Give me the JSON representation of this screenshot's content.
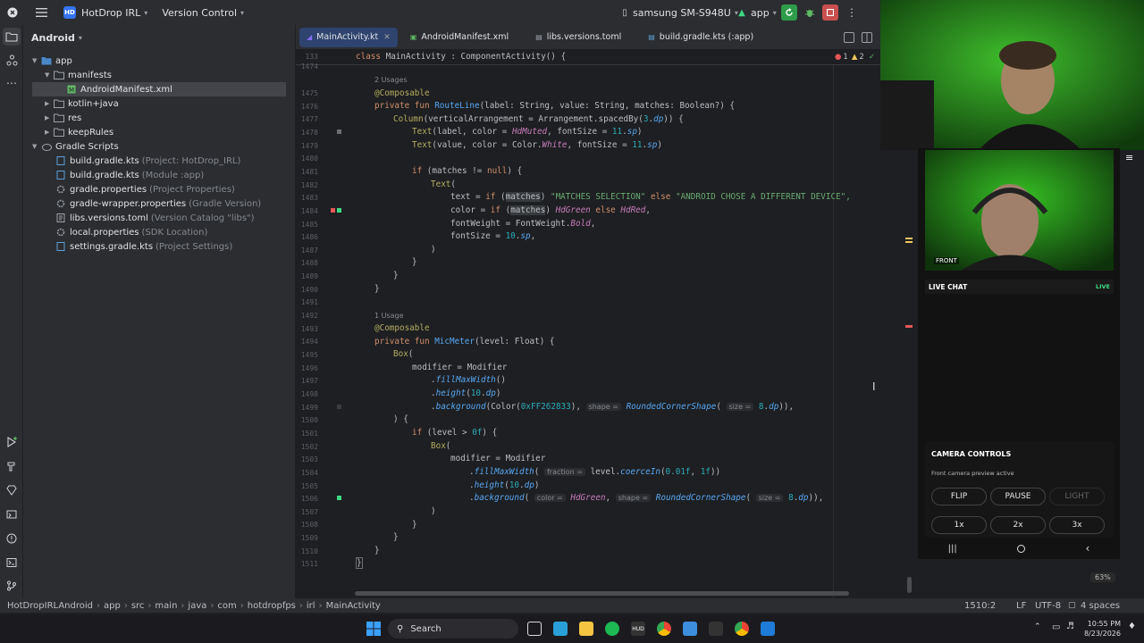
{
  "titlebar": {
    "project_badge": "HD",
    "project_name": "HotDrop IRL",
    "vcs": "Version Control",
    "device": "samsung SM-S948U",
    "run_config": "app"
  },
  "project_panel": {
    "view": "Android",
    "tree": [
      {
        "label": "app",
        "hint": ""
      },
      {
        "label": "manifests",
        "hint": ""
      },
      {
        "label": "AndroidManifest.xml",
        "hint": ""
      },
      {
        "label": "kotlin+java",
        "hint": ""
      },
      {
        "label": "res",
        "hint": ""
      },
      {
        "label": "keepRules",
        "hint": ""
      },
      {
        "label": "Gradle Scripts",
        "hint": ""
      },
      {
        "label": "build.gradle.kts",
        "hint": "(Project: HotDrop_IRL)"
      },
      {
        "label": "build.gradle.kts",
        "hint": "(Module :app)"
      },
      {
        "label": "gradle.properties",
        "hint": "(Project Properties)"
      },
      {
        "label": "gradle-wrapper.properties",
        "hint": "(Gradle Version)"
      },
      {
        "label": "libs.versions.toml",
        "hint": "(Version Catalog \"libs\")"
      },
      {
        "label": "local.properties",
        "hint": "(SDK Location)"
      },
      {
        "label": "settings.gradle.kts",
        "hint": "(Project Settings)"
      }
    ]
  },
  "tabs": [
    {
      "label": "MainActivity.kt"
    },
    {
      "label": "AndroidManifest.xml"
    },
    {
      "label": "libs.versions.toml"
    },
    {
      "label": "build.gradle.kts (:app)"
    }
  ],
  "editor": {
    "sticky_line_num": "133",
    "sticky_code": "class MainActivity : ComponentActivity() {",
    "errors": "1",
    "warnings": "2",
    "first_num": "1474",
    "usages_1": "2 Usages",
    "usages_2": "1 Usage",
    "line_numbers": [
      "1475",
      "1476",
      "1477",
      "1478",
      "1479",
      "1480",
      "1481",
      "1482",
      "1483",
      "1484",
      "1485",
      "1486",
      "1487",
      "1488",
      "1489",
      "1490",
      "1491",
      "1492",
      "1493",
      "1494",
      "1495",
      "1496",
      "1497",
      "1498",
      "1499",
      "1500",
      "1501",
      "1502",
      "1503",
      "1504",
      "1505",
      "1506",
      "1507",
      "1508",
      "1509",
      "1510",
      "1511"
    ],
    "hints": {
      "shape": "shape =",
      "size": "size =",
      "fraction": "fraction =",
      "color": "color ="
    },
    "strings": {
      "matches_selection": "\"MATCHES SELECTION\"",
      "android_chose": "\"ANDROID CHOSE A DIFFERENT DEVICE\","
    }
  },
  "statusbar": {
    "crumbs": [
      "HotDropIRLAndroid",
      "app",
      "src",
      "main",
      "java",
      "com",
      "hotdropfps",
      "irl",
      "MainActivity"
    ],
    "position": "1510:2",
    "line_sep": "LF",
    "encoding": "UTF-8",
    "indent": "4 spaces"
  },
  "phone": {
    "front_label": "FRONT",
    "live_chat": "LIVE CHAT",
    "live": "LIVE",
    "camera_controls": "CAMERA CONTROLS",
    "camera_status": "Front camera preview active",
    "buttons": {
      "flip": "FLIP",
      "pause": "PAUSE",
      "light": "LIGHT",
      "z1": "1x",
      "z2": "2x",
      "z3": "3x"
    },
    "battery": "63%"
  },
  "taskbar": {
    "search": "Search",
    "time": "10:55 PM",
    "date": "8/23/2026"
  },
  "colors": {
    "accent": "#3574f0",
    "live_green": "#3ddc84",
    "editor_bg": "#1e1f22"
  }
}
